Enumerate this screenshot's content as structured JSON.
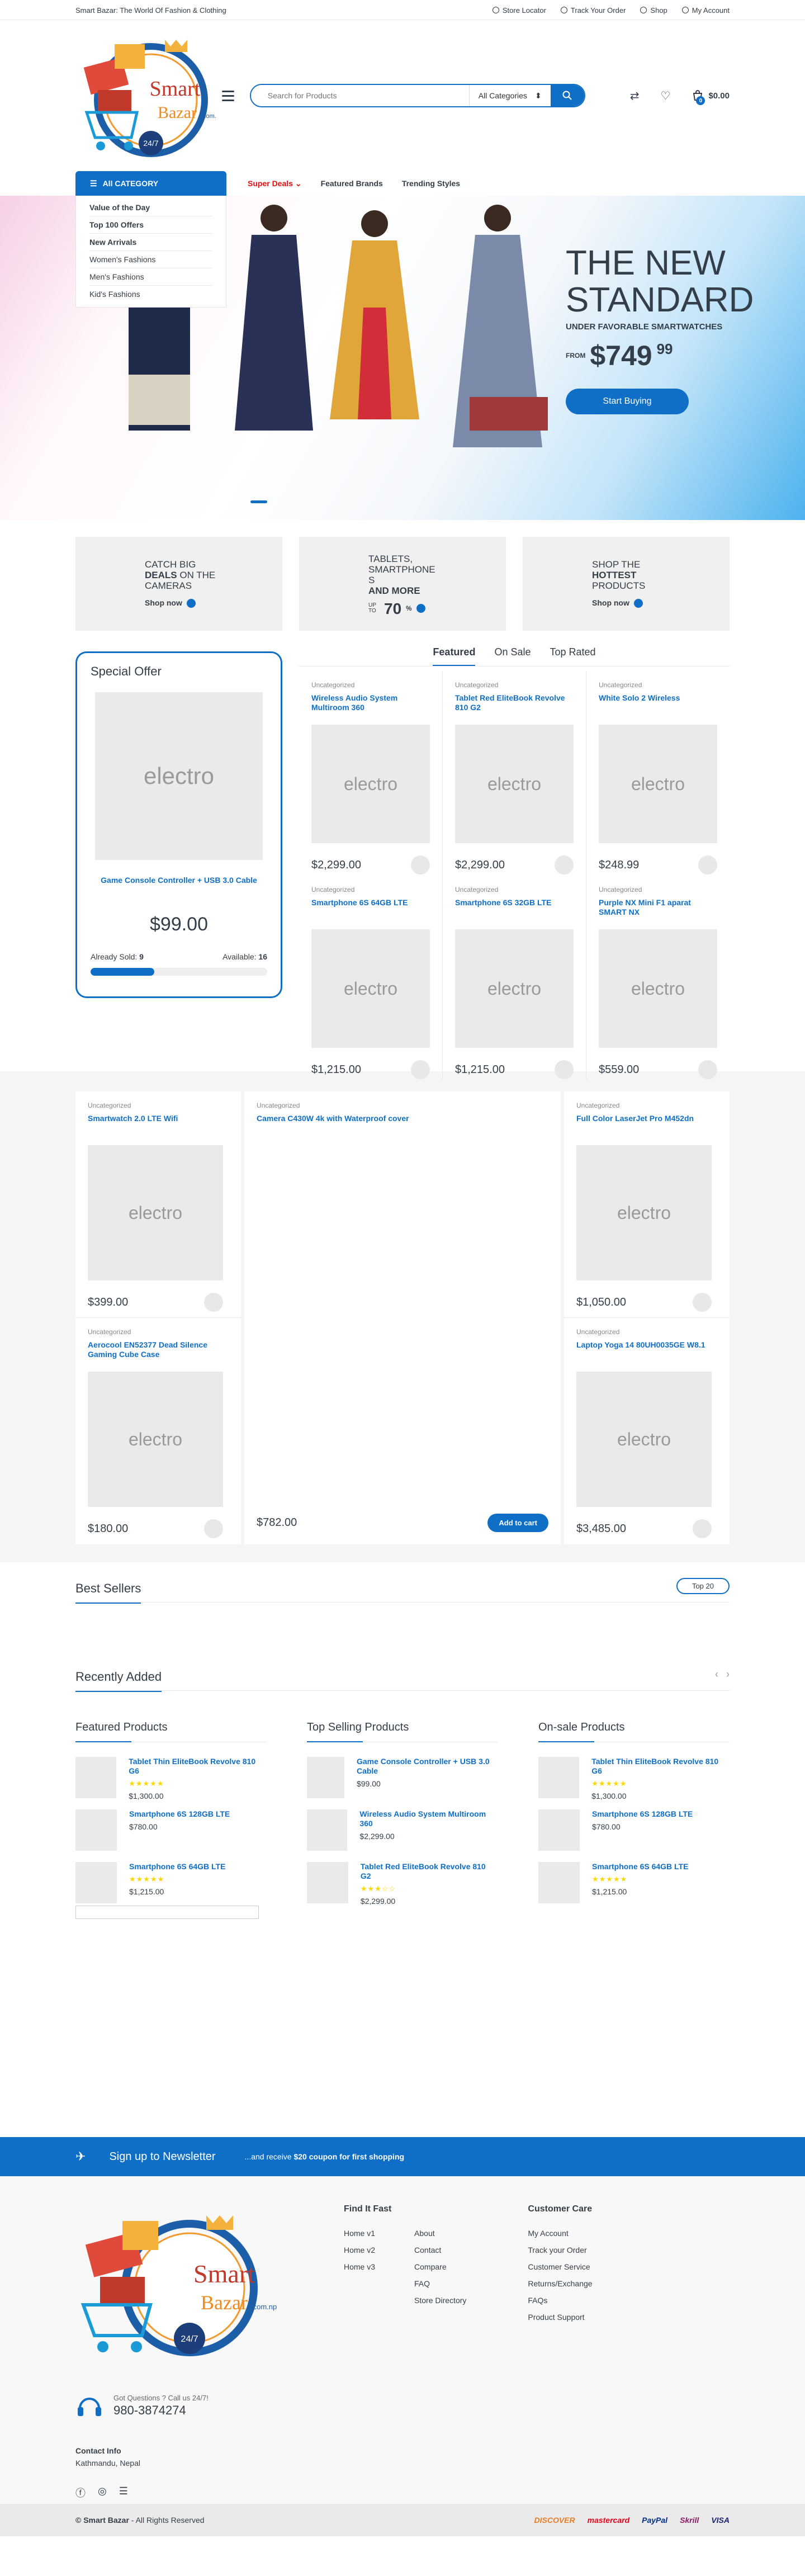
{
  "topbar": {
    "welcome": "Smart Bazar: The World Of Fashion & Clothing",
    "links": [
      "Store Locator",
      "Track Your Order",
      "Shop",
      "My Account"
    ]
  },
  "header": {
    "logo_text": "Smart Bazar.com.np",
    "search_placeholder": "Search for Products",
    "category_select": "All Categories",
    "cart_total": "$0.00",
    "cart_count": "0"
  },
  "nav": {
    "all_category": "All CATEGORY",
    "links": [
      "Super Deals",
      "Featured Brands",
      "Trending Styles"
    ]
  },
  "category_menu": [
    "Value of the Day",
    "Top 100 Offers",
    "New Arrivals",
    "Women's Fashions",
    "Men's Fashions",
    "Kid's Fashions"
  ],
  "hero": {
    "line1": "THE NEW",
    "line2": "STANDARD",
    "subtitle": "UNDER FAVORABLE SMARTWATCHES",
    "from": "FROM",
    "price_main": "$749",
    "price_cents": "99",
    "button": "Start Buying"
  },
  "banners": [
    {
      "l1": "CATCH BIG",
      "l2b": "DEALS",
      "l2": " ON THE",
      "l3": "CAMERAS",
      "link": "Shop now"
    },
    {
      "l1": "TABLETS,",
      "l2": "SMARTPHONE",
      "l3": "S",
      "l4b": "AND MORE",
      "pct": "70",
      "link": "UP TO"
    },
    {
      "l1": "SHOP THE",
      "l2b": "HOTTEST",
      "l3": "PRODUCTS",
      "link": "Shop now"
    }
  ],
  "special": {
    "title": "Special Offer",
    "name": "Game Console Controller + USB 3.0 Cable",
    "price": "$99.00",
    "sold_label": "Already Sold:",
    "sold": "9",
    "avail_label": "Available:",
    "avail": "16",
    "sold_fraction": 0.36
  },
  "tabs": [
    "Featured",
    "On Sale",
    "Top Rated"
  ],
  "placeholder": "electro",
  "featured_products": [
    {
      "cat": "Uncategorized",
      "name": "Wireless Audio System Multiroom 360",
      "price": "$2,299.00"
    },
    {
      "cat": "Uncategorized",
      "name": "Tablet Red EliteBook Revolve 810 G2",
      "price": "$2,299.00"
    },
    {
      "cat": "Uncategorized",
      "name": "White Solo 2 Wireless",
      "price": "$248.99"
    },
    {
      "cat": "Uncategorized",
      "name": "Smartphone 6S 64GB LTE",
      "price": "$1,215.00"
    },
    {
      "cat": "Uncategorized",
      "name": "Smartphone 6S 32GB LTE",
      "price": "$1,215.00"
    },
    {
      "cat": "Uncategorized",
      "name": "Purple NX Mini F1 aparat SMART NX",
      "price": "$559.00"
    }
  ],
  "grey_left": [
    {
      "cat": "Uncategorized",
      "name": "Smartwatch 2.0 LTE Wifi",
      "price": "$399.00"
    },
    {
      "cat": "Uncategorized",
      "name": "Aerocool EN52377 Dead Silence Gaming Cube Case",
      "price": "$180.00"
    }
  ],
  "grey_mid": {
    "cat": "Uncategorized",
    "name": "Camera C430W 4k with Waterproof cover",
    "price": "$782.00",
    "button": "Add to cart"
  },
  "grey_right": [
    {
      "cat": "Uncategorized",
      "name": "Full Color LaserJet Pro M452dn",
      "price": "$1,050.00"
    },
    {
      "cat": "Uncategorized",
      "name": "Laptop Yoga 14 80UH0035GE W8.1",
      "price": "$3,485.00"
    }
  ],
  "best_sellers": {
    "title": "Best Sellers",
    "tab": "Top 20"
  },
  "recently_added": {
    "title": "Recently Added"
  },
  "lists": [
    {
      "title": "Featured Products",
      "items": [
        {
          "name": "Tablet Thin EliteBook Revolve 810 G6",
          "price": "$1,300.00",
          "stars": "★★★★★"
        },
        {
          "name": "Smartphone 6S 128GB LTE",
          "price": "$780.00",
          "stars": ""
        },
        {
          "name": "Smartphone 6S 64GB LTE",
          "price": "$1,215.00",
          "stars": "★★★★★"
        }
      ]
    },
    {
      "title": "Top Selling Products",
      "items": [
        {
          "name": "Game Console Controller + USB 3.0 Cable",
          "price": "$99.00",
          "stars": ""
        },
        {
          "name": "Wireless Audio System Multiroom 360",
          "price": "$2,299.00",
          "stars": ""
        },
        {
          "name": "Tablet Red EliteBook Revolve 810 G2",
          "price": "$2,299.00",
          "stars": "★★★☆☆"
        }
      ]
    },
    {
      "title": "On-sale Products",
      "items": [
        {
          "name": "Tablet Thin EliteBook Revolve 810 G6",
          "price": "$1,300.00",
          "stars": "★★★★★"
        },
        {
          "name": "Smartphone 6S 128GB LTE",
          "price": "$780.00",
          "stars": ""
        },
        {
          "name": "Smartphone 6S 64GB LTE",
          "price": "$1,215.00",
          "stars": "★★★★★"
        }
      ]
    }
  ],
  "newsletter": {
    "title": "Sign up to Newsletter",
    "text_pre": "...and receive ",
    "text_bold": "$20 coupon for first shopping"
  },
  "footer": {
    "support_label": "Got Questions ? Call us 24/7!",
    "phone": "980-3874274",
    "contact_title": "Contact Info",
    "contact_addr": "Kathmandu, Nepal",
    "find_title": "Find It Fast",
    "find_col1": [
      "Home v1",
      "Home v2",
      "Home v3"
    ],
    "find_col2": [
      "About",
      "Contact",
      "Compare",
      "FAQ",
      "Store Directory"
    ],
    "care_title": "Customer Care",
    "care": [
      "My Account",
      "Track your Order",
      "Customer Service",
      "Returns/Exchange",
      "FAQs",
      "Product Support"
    ],
    "copyright_b": "© Smart Bazar",
    "copyright": " - All Rights Reserved",
    "payments": [
      "DISCOVER",
      "mastercard",
      "PayPal",
      "Skrill",
      "VISA"
    ]
  },
  "colors": {
    "accent": "#0f6fc6",
    "deal": "#e40f0f",
    "star": "#fed700"
  }
}
